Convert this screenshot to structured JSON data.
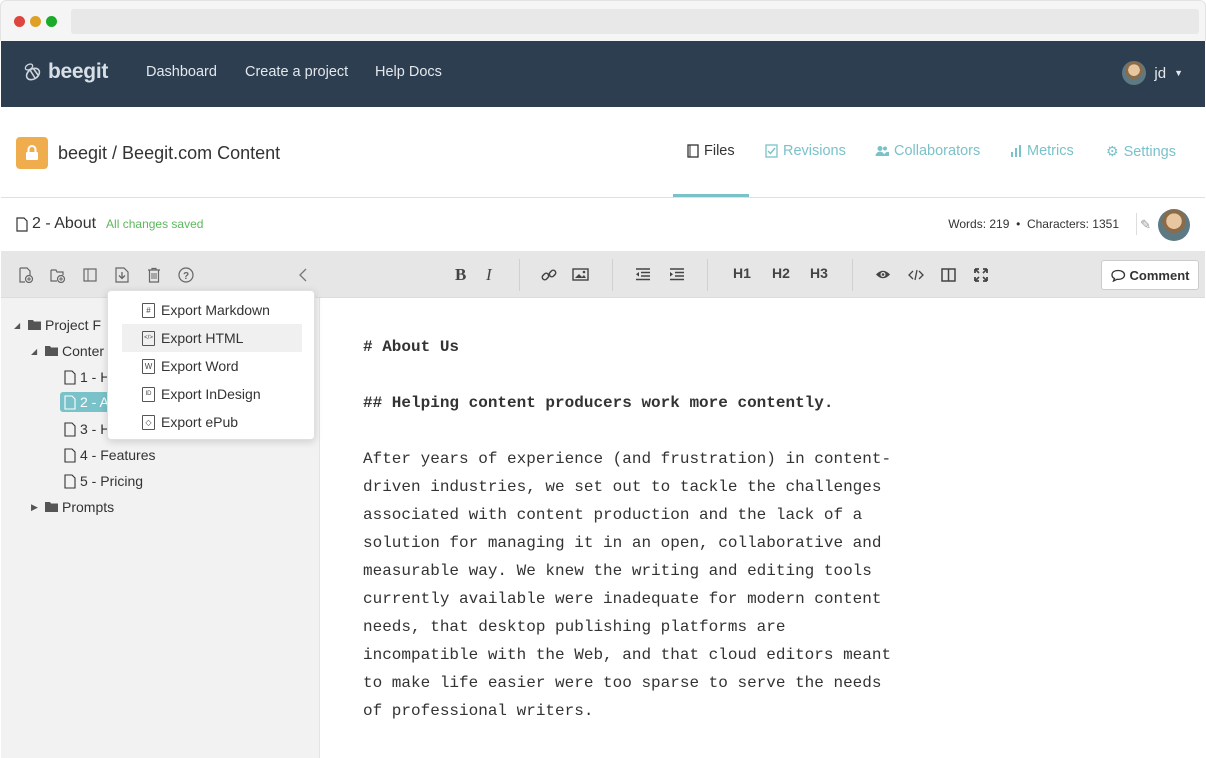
{
  "nav": {
    "logo": "beegit",
    "links": [
      "Dashboard",
      "Create a project",
      "Help Docs"
    ],
    "user": "jd"
  },
  "project": {
    "title": "beegit / Beegit.com Content",
    "tabs": [
      "Files",
      "Revisions",
      "Collaborators",
      "Metrics",
      "Settings"
    ],
    "active_tab": "Files"
  },
  "file": {
    "name": "2 - About",
    "status": "All changes saved",
    "stats": "Words: 219  •  Characters: 1351"
  },
  "tree": {
    "root": "Project F",
    "folder": "Conter",
    "items": [
      "1 - H",
      "2 - A",
      "3 - H",
      "4 - Features",
      "5 - Pricing"
    ],
    "prompts": "Prompts"
  },
  "toolbar": {
    "bold": "B",
    "italic": "I",
    "h1": "H1",
    "h2": "H2",
    "h3": "H3",
    "comment": "Comment"
  },
  "export_menu": [
    {
      "label": "Export Markdown",
      "icon": "markdown-icon"
    },
    {
      "label": "Export HTML",
      "icon": "html-icon"
    },
    {
      "label": "Export Word",
      "icon": "word-icon"
    },
    {
      "label": "Export InDesign",
      "icon": "indesign-icon"
    },
    {
      "label": "Export ePub",
      "icon": "epub-icon"
    }
  ],
  "editor": {
    "h1": "# About Us",
    "h2": "## Helping content producers work more contently.",
    "body": "After years of experience (and frustration) in content-\ndriven industries, we set out to tackle the challenges\nassociated with content production and the lack of a\nsolution for managing it in an open, collaborative and\nmeasurable way. We knew the writing and editing tools\ncurrently available were inadequate for modern content\nneeds, that desktop publishing platforms are\nincompatible with the Web, and that cloud editors meant\nto make life easier were too sparse to serve the needs\nof professional writers."
  },
  "colors": {
    "nav_bg": "#2c3e50",
    "accent": "#7ac2c9",
    "lock": "#f0ad4e",
    "saved": "#5cb85c"
  }
}
